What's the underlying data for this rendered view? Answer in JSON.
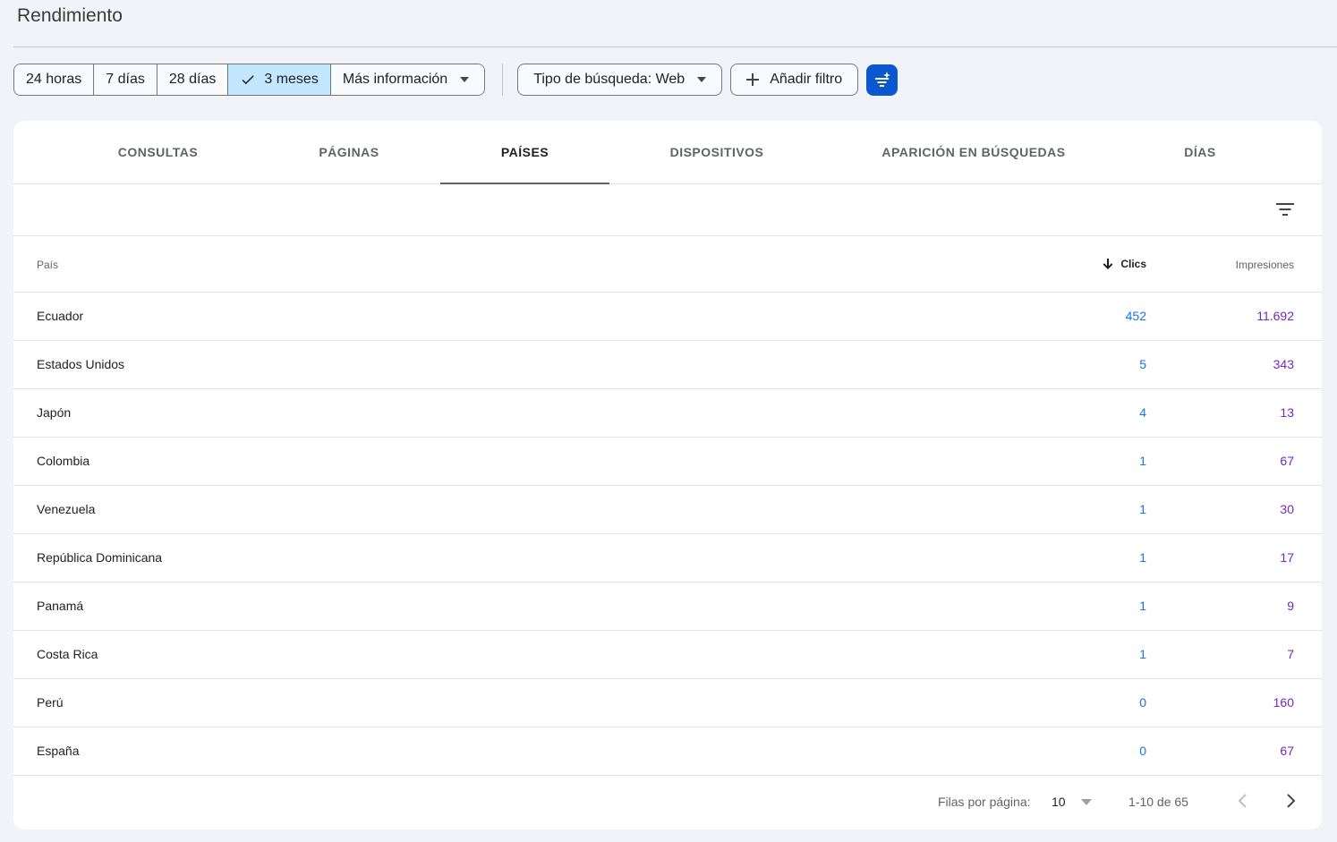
{
  "page": {
    "title": "Rendimiento"
  },
  "date_ranges": [
    {
      "label": "24 horas",
      "selected": false
    },
    {
      "label": "7 días",
      "selected": false
    },
    {
      "label": "28 días",
      "selected": false
    },
    {
      "label": "3 meses",
      "selected": true
    },
    {
      "label": "Más información",
      "selected": false
    }
  ],
  "search_type": {
    "label": "Tipo de búsqueda: Web"
  },
  "add_filter": {
    "label": "Añadir filtro"
  },
  "tabs": [
    {
      "label": "CONSULTAS",
      "active": false
    },
    {
      "label": "PÁGINAS",
      "active": false
    },
    {
      "label": "PAÍSES",
      "active": true
    },
    {
      "label": "DISPOSITIVOS",
      "active": false
    },
    {
      "label": "APARICIÓN EN BÚSQUEDAS",
      "active": false
    },
    {
      "label": "DÍAS",
      "active": false
    }
  ],
  "table": {
    "headers": {
      "country": "País",
      "clicks": "Clics",
      "impressions": "Impresiones"
    },
    "sorted_by": "clicks",
    "sort_direction": "descending",
    "rows": [
      {
        "country": "Ecuador",
        "clicks": "452",
        "impressions": "11.692"
      },
      {
        "country": "Estados Unidos",
        "clicks": "5",
        "impressions": "343"
      },
      {
        "country": "Japón",
        "clicks": "4",
        "impressions": "13"
      },
      {
        "country": "Colombia",
        "clicks": "1",
        "impressions": "67"
      },
      {
        "country": "Venezuela",
        "clicks": "1",
        "impressions": "30"
      },
      {
        "country": "República Dominicana",
        "clicks": "1",
        "impressions": "17"
      },
      {
        "country": "Panamá",
        "clicks": "1",
        "impressions": "9"
      },
      {
        "country": "Costa Rica",
        "clicks": "1",
        "impressions": "7"
      },
      {
        "country": "Perú",
        "clicks": "0",
        "impressions": "160"
      },
      {
        "country": "España",
        "clicks": "0",
        "impressions": "67"
      }
    ]
  },
  "pagination": {
    "rows_per_page_label": "Filas por página:",
    "rows_per_page": "10",
    "range": "1-10 de 65"
  },
  "colors": {
    "clicks": "#1a73e8",
    "impressions": "#7627bb",
    "selected_segment": "#c2e7ff",
    "primary_button": "#0b57d0"
  },
  "icons": [
    "check-icon",
    "dropdown-caret-icon",
    "plus-icon",
    "filter-sparkle-icon",
    "filter-list-icon",
    "arrow-down-icon",
    "chevron-left-icon",
    "chevron-right-icon"
  ]
}
